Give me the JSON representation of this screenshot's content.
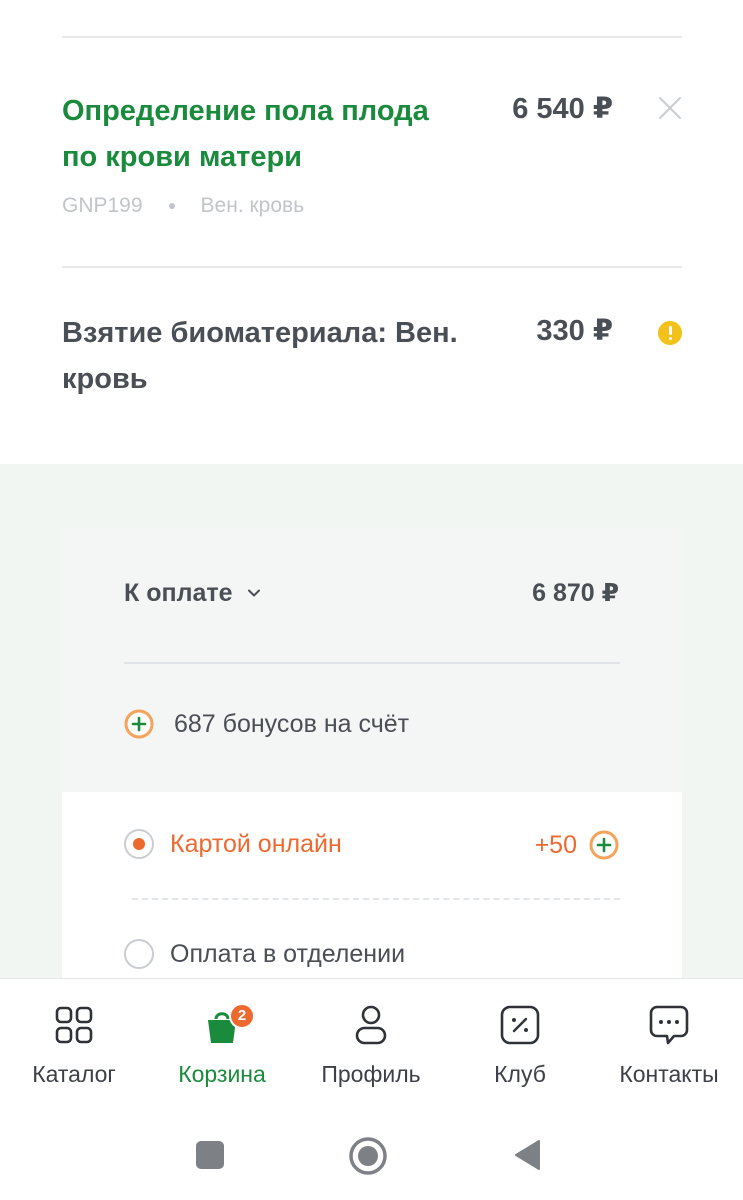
{
  "cart_item": {
    "title": "Определение пола плода по крови матери",
    "price": "6 540 ₽",
    "code": "GNP199",
    "biomaterial": "Вен. кровь",
    "remove_icon": "close-icon"
  },
  "biomaterial_item": {
    "title": "Взятие биоматериала: Вен. кровь",
    "price": "330 ₽",
    "icon": "warning-icon"
  },
  "summary": {
    "pay_label": "К оплате",
    "total": "6 870 ₽",
    "bonus_text": "687 бонусов на счёт"
  },
  "payment_methods": [
    {
      "label": "Картой онлайн",
      "bonus": "+50",
      "selected": true
    },
    {
      "label": "Оплата в отделении",
      "selected": false
    }
  ],
  "tabbar": {
    "items": [
      {
        "label": "Каталог",
        "icon": "grid-icon"
      },
      {
        "label": "Корзина",
        "icon": "cart-bag-icon",
        "badge": "2",
        "active": true
      },
      {
        "label": "Профиль",
        "icon": "user-icon"
      },
      {
        "label": "Клуб",
        "icon": "percent-icon"
      },
      {
        "label": "Контакты",
        "icon": "chat-icon"
      }
    ]
  },
  "system_nav": [
    "square-recents-icon",
    "circle-home-icon",
    "triangle-back-icon"
  ],
  "colors": {
    "accent_green": "#1a8a3c",
    "accent_orange": "#ec6a2f",
    "warning_yellow": "#f2c21b",
    "section_bg": "#f1f6f3"
  }
}
